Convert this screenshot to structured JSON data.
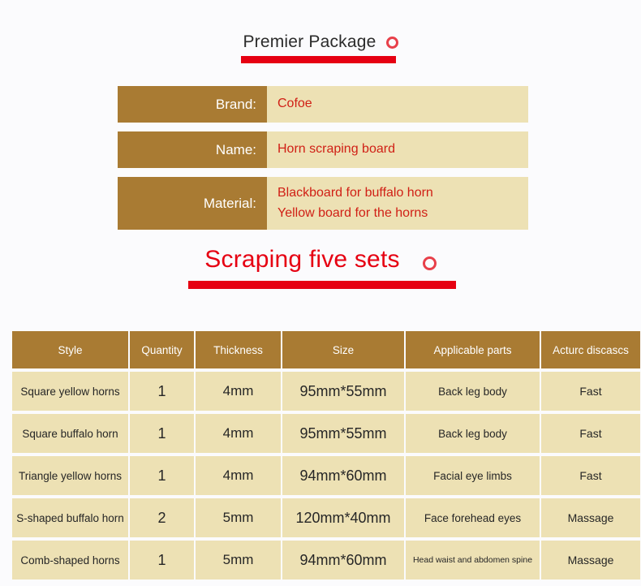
{
  "theme": {
    "brown": "#A97B33",
    "cream": "#EDE1B4",
    "red": "#E60012",
    "value_red": "#D01F15",
    "background": "#FBFBFD"
  },
  "headings": {
    "premier": {
      "text": "Premier Package",
      "icon": "ring-icon"
    },
    "scraping": {
      "text": "Scraping five sets",
      "icon": "ring-icon"
    }
  },
  "spec_table": {
    "rows": [
      {
        "label": "Brand:",
        "values": [
          "Cofoe"
        ]
      },
      {
        "label": "Name:",
        "values": [
          "Horn scraping board"
        ]
      },
      {
        "label": "Material:",
        "values": [
          "Blackboard for buffalo horn",
          "Yellow board for the horns"
        ]
      }
    ]
  },
  "sets_table": {
    "headers": [
      "Style",
      "Quantity",
      "Thickness",
      "Size",
      "Applicable parts",
      "Acturc discascs"
    ],
    "rows": [
      {
        "style": "Square yellow horns",
        "quantity": "1",
        "thickness": "4mm",
        "size": "95mm*55mm",
        "parts": "Back leg body",
        "action": "Fast"
      },
      {
        "style": "Square buffalo horn",
        "quantity": "1",
        "thickness": "4mm",
        "size": "95mm*55mm",
        "parts": "Back leg body",
        "action": "Fast"
      },
      {
        "style": "Triangle yellow horns",
        "quantity": "1",
        "thickness": "4mm",
        "size": "94mm*60mm",
        "parts": "Facial eye limbs",
        "action": "Fast"
      },
      {
        "style": "S-shaped buffalo horn",
        "quantity": "2",
        "thickness": "5mm",
        "size": "120mm*40mm",
        "parts": "Face forehead eyes",
        "action": "Massage"
      },
      {
        "style": "Comb-shaped horns",
        "quantity": "1",
        "thickness": "5mm",
        "size": "94mm*60mm",
        "parts": "Head waist and abdomen spine",
        "action": "Massage"
      }
    ]
  }
}
